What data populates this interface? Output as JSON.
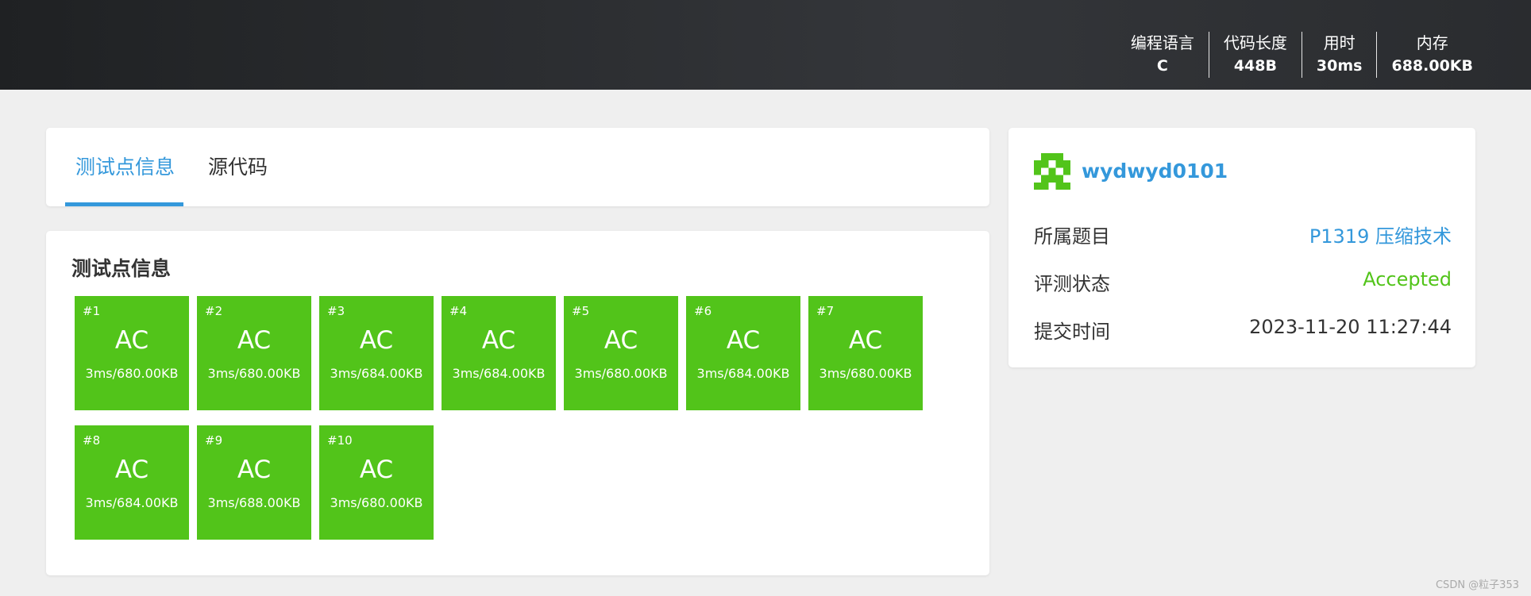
{
  "header": {
    "stats": [
      {
        "label": "编程语言",
        "value": "C"
      },
      {
        "label": "代码长度",
        "value": "448B"
      },
      {
        "label": "用时",
        "value": "30ms"
      },
      {
        "label": "内存",
        "value": "688.00KB"
      }
    ]
  },
  "tabs": [
    {
      "label": "测试点信息",
      "active": true
    },
    {
      "label": "源代码",
      "active": false
    }
  ],
  "tests": {
    "title": "测试点信息",
    "status_color": "#52c41a",
    "items": [
      {
        "id": "#1",
        "status": "AC",
        "detail": "3ms/680.00KB"
      },
      {
        "id": "#2",
        "status": "AC",
        "detail": "3ms/680.00KB"
      },
      {
        "id": "#3",
        "status": "AC",
        "detail": "3ms/684.00KB"
      },
      {
        "id": "#4",
        "status": "AC",
        "detail": "3ms/684.00KB"
      },
      {
        "id": "#5",
        "status": "AC",
        "detail": "3ms/680.00KB"
      },
      {
        "id": "#6",
        "status": "AC",
        "detail": "3ms/684.00KB"
      },
      {
        "id": "#7",
        "status": "AC",
        "detail": "3ms/680.00KB"
      },
      {
        "id": "#8",
        "status": "AC",
        "detail": "3ms/684.00KB"
      },
      {
        "id": "#9",
        "status": "AC",
        "detail": "3ms/688.00KB"
      },
      {
        "id": "#10",
        "status": "AC",
        "detail": "3ms/680.00KB"
      }
    ]
  },
  "user": {
    "name": "wydwyd0101",
    "avatar_icon": "identicon-avatar",
    "accent": "#3498db"
  },
  "details": [
    {
      "label": "所属题目",
      "value": "P1319 压缩技术",
      "type": "link"
    },
    {
      "label": "评测状态",
      "value": "Accepted",
      "type": "ok"
    },
    {
      "label": "提交时间",
      "value": "2023-11-20 11:27:44",
      "type": "dark"
    }
  ],
  "watermark": "CSDN @粒子353"
}
